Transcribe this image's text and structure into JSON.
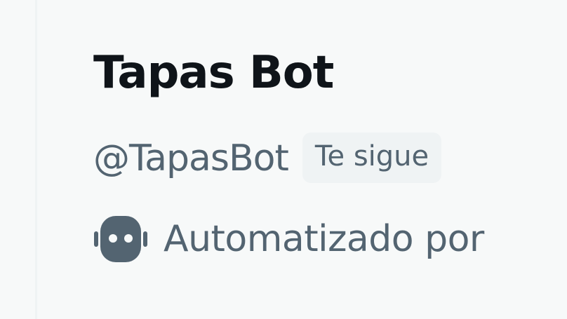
{
  "profile": {
    "display_name": "Tapas Bot",
    "handle": "@TapasBot",
    "follows_you_label": "Te sigue",
    "automated_label": "Automatizado por",
    "automated_icon": "robot-icon"
  },
  "colors": {
    "name_text": "#0f1419",
    "secondary_text": "#536471",
    "badge_background": "#eff3f4",
    "page_background": "#f7f9f9"
  }
}
